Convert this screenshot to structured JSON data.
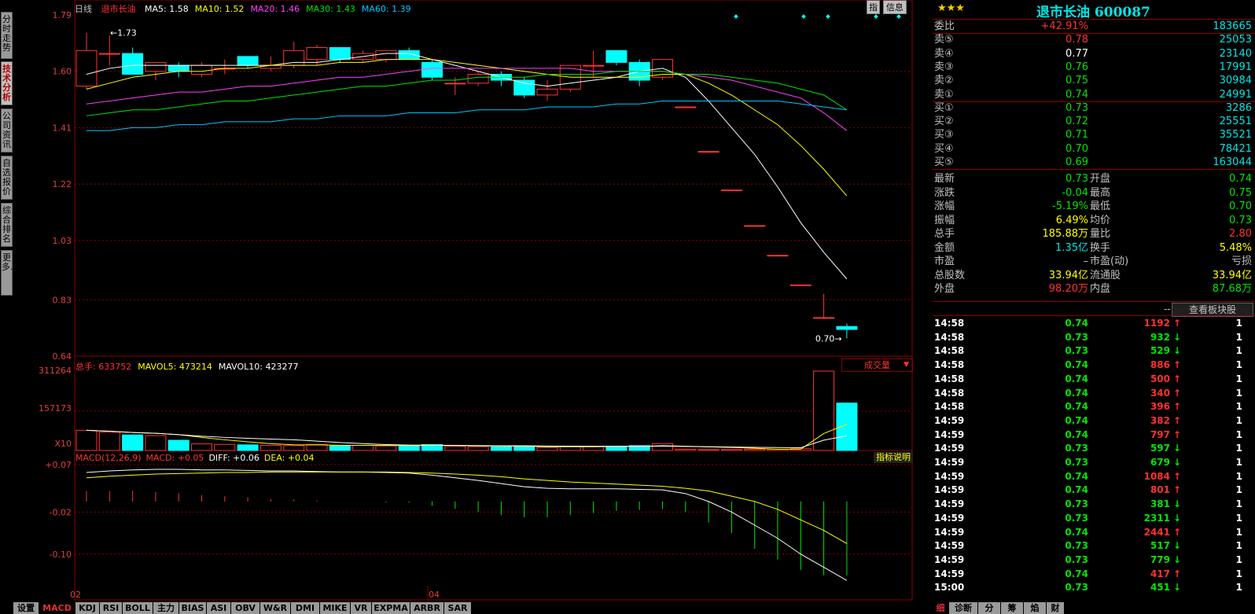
{
  "left_tabs": [
    "分时走势",
    "技术分析",
    "公司资讯",
    "自选报价",
    "综合排名",
    "更多..."
  ],
  "left_tab_active": 1,
  "chart": {
    "period_label": "日线",
    "stock_name": "退市长油",
    "ma_labels": [
      {
        "text": "MA5: 1.58",
        "color": "#ffffff"
      },
      {
        "text": "MA10: 1.52",
        "color": "#ffff00"
      },
      {
        "text": "MA20: 1.46",
        "color": "#ff40ff"
      },
      {
        "text": "MA30: 1.43",
        "color": "#00e600"
      },
      {
        "text": "MA60: 1.39",
        "color": "#00c8ff"
      }
    ],
    "top_buttons": [
      "指",
      "信息"
    ],
    "price_ticks": [
      "1.79",
      "1.60",
      "1.41",
      "1.22",
      "1.03",
      "0.83",
      "0.64"
    ],
    "high_note": "1.73",
    "low_note": "0.70",
    "volume_header": [
      {
        "text": "总手: 633752",
        "color": "#ff3232"
      },
      {
        "text": "MAVOL5: 473214",
        "color": "#ffff00"
      },
      {
        "text": "MAVOL10: 423277",
        "color": "#ffffff"
      }
    ],
    "volume_selector": "成交量",
    "volume_ticks": [
      "311264",
      "157173",
      "X10"
    ],
    "macd_header": [
      {
        "text": "MACD(12,26,9)",
        "color": "#ff3232"
      },
      {
        "text": "MACD: +0.05",
        "color": "#ff3232"
      },
      {
        "text": "DIFF: +0.06",
        "color": "#ffffff"
      },
      {
        "text": "DEA: +0.04",
        "color": "#ffff00"
      }
    ],
    "macd_help": "指标说明",
    "macd_ticks": [
      "+0.07",
      "-0.02",
      "-0.10"
    ],
    "date_labels": [
      "02",
      "04"
    ]
  },
  "chart_data": {
    "type": "candlestick",
    "title": "退市长油",
    "ylim": [
      0.64,
      1.79
    ],
    "candles": [
      {
        "o": 1.55,
        "h": 1.73,
        "l": 1.54,
        "c": 1.67
      },
      {
        "o": 1.66,
        "h": 1.72,
        "l": 1.62,
        "c": 1.66
      },
      {
        "o": 1.66,
        "h": 1.68,
        "l": 1.59,
        "c": 1.59
      },
      {
        "o": 1.6,
        "h": 1.63,
        "l": 1.57,
        "c": 1.63
      },
      {
        "o": 1.62,
        "h": 1.63,
        "l": 1.58,
        "c": 1.6
      },
      {
        "o": 1.59,
        "h": 1.63,
        "l": 1.58,
        "c": 1.62
      },
      {
        "o": 1.61,
        "h": 1.64,
        "l": 1.59,
        "c": 1.61
      },
      {
        "o": 1.65,
        "h": 1.65,
        "l": 1.61,
        "c": 1.62
      },
      {
        "o": 1.61,
        "h": 1.65,
        "l": 1.6,
        "c": 1.62
      },
      {
        "o": 1.62,
        "h": 1.7,
        "l": 1.61,
        "c": 1.67
      },
      {
        "o": 1.64,
        "h": 1.69,
        "l": 1.62,
        "c": 1.68
      },
      {
        "o": 1.68,
        "h": 1.68,
        "l": 1.63,
        "c": 1.64
      },
      {
        "o": 1.64,
        "h": 1.67,
        "l": 1.63,
        "c": 1.66
      },
      {
        "o": 1.64,
        "h": 1.67,
        "l": 1.63,
        "c": 1.67
      },
      {
        "o": 1.67,
        "h": 1.68,
        "l": 1.64,
        "c": 1.64
      },
      {
        "o": 1.63,
        "h": 1.64,
        "l": 1.57,
        "c": 1.58
      },
      {
        "o": 1.56,
        "h": 1.58,
        "l": 1.52,
        "c": 1.56
      },
      {
        "o": 1.56,
        "h": 1.6,
        "l": 1.55,
        "c": 1.59
      },
      {
        "o": 1.59,
        "h": 1.6,
        "l": 1.55,
        "c": 1.57
      },
      {
        "o": 1.57,
        "h": 1.58,
        "l": 1.51,
        "c": 1.52
      },
      {
        "o": 1.52,
        "h": 1.57,
        "l": 1.5,
        "c": 1.54
      },
      {
        "o": 1.54,
        "h": 1.62,
        "l": 1.53,
        "c": 1.62
      },
      {
        "o": 1.62,
        "h": 1.67,
        "l": 1.58,
        "c": 1.62
      },
      {
        "o": 1.67,
        "h": 1.67,
        "l": 1.62,
        "c": 1.63
      },
      {
        "o": 1.63,
        "h": 1.64,
        "l": 1.55,
        "c": 1.57
      },
      {
        "o": 1.58,
        "h": 1.64,
        "l": 1.57,
        "c": 1.64
      },
      {
        "o": 1.48,
        "h": 1.48,
        "l": 1.48,
        "c": 1.48
      },
      {
        "o": 1.33,
        "h": 1.33,
        "l": 1.33,
        "c": 1.33
      },
      {
        "o": 1.2,
        "h": 1.2,
        "l": 1.2,
        "c": 1.2
      },
      {
        "o": 1.08,
        "h": 1.08,
        "l": 1.08,
        "c": 1.08
      },
      {
        "o": 0.98,
        "h": 0.98,
        "l": 0.98,
        "c": 0.98
      },
      {
        "o": 0.88,
        "h": 0.88,
        "l": 0.88,
        "c": 0.88
      },
      {
        "o": 0.77,
        "h": 0.85,
        "l": 0.77,
        "c": 0.77
      },
      {
        "o": 0.74,
        "h": 0.75,
        "l": 0.7,
        "c": 0.73
      }
    ],
    "ma_series": {
      "MA5": [
        1.59,
        1.61,
        1.62,
        1.62,
        1.62,
        1.62,
        1.62,
        1.62,
        1.62,
        1.63,
        1.63,
        1.64,
        1.65,
        1.66,
        1.66,
        1.64,
        1.62,
        1.6,
        1.58,
        1.56,
        1.55,
        1.56,
        1.57,
        1.58,
        1.6,
        1.61,
        1.58,
        1.5,
        1.41,
        1.32,
        1.21,
        1.09,
        0.99,
        0.9
      ],
      "MA10": [
        1.54,
        1.56,
        1.58,
        1.59,
        1.6,
        1.6,
        1.61,
        1.61,
        1.62,
        1.62,
        1.62,
        1.63,
        1.63,
        1.64,
        1.64,
        1.64,
        1.63,
        1.62,
        1.61,
        1.6,
        1.59,
        1.58,
        1.58,
        1.58,
        1.58,
        1.59,
        1.59,
        1.56,
        1.52,
        1.47,
        1.42,
        1.35,
        1.27,
        1.18
      ],
      "MA20": [
        1.49,
        1.5,
        1.51,
        1.52,
        1.53,
        1.53,
        1.54,
        1.55,
        1.55,
        1.56,
        1.57,
        1.58,
        1.58,
        1.59,
        1.6,
        1.61,
        1.61,
        1.61,
        1.61,
        1.61,
        1.61,
        1.61,
        1.6,
        1.6,
        1.6,
        1.6,
        1.59,
        1.58,
        1.57,
        1.55,
        1.53,
        1.51,
        1.46,
        1.4
      ],
      "MA30": [
        1.45,
        1.46,
        1.47,
        1.47,
        1.48,
        1.49,
        1.5,
        1.5,
        1.51,
        1.52,
        1.53,
        1.54,
        1.55,
        1.55,
        1.56,
        1.57,
        1.57,
        1.58,
        1.58,
        1.58,
        1.59,
        1.59,
        1.59,
        1.6,
        1.6,
        1.6,
        1.59,
        1.59,
        1.58,
        1.57,
        1.56,
        1.54,
        1.52,
        1.47
      ],
      "MA60": [
        1.4,
        1.4,
        1.41,
        1.41,
        1.42,
        1.42,
        1.43,
        1.43,
        1.43,
        1.44,
        1.44,
        1.45,
        1.45,
        1.45,
        1.46,
        1.46,
        1.46,
        1.47,
        1.47,
        1.47,
        1.48,
        1.48,
        1.48,
        1.49,
        1.49,
        1.5,
        1.5,
        1.5,
        1.5,
        1.5,
        1.5,
        1.49,
        1.48,
        1.47
      ]
    },
    "volume": [
      79000,
      72000,
      61000,
      58000,
      40000,
      26000,
      24000,
      22000,
      20000,
      19000,
      24000,
      18000,
      20000,
      18000,
      19000,
      23000,
      16000,
      15000,
      14000,
      17000,
      12000,
      16000,
      15000,
      17000,
      19000,
      27000,
      5000,
      4000,
      4000,
      5000,
      5000,
      7000,
      311264,
      185880
    ],
    "macd_ylim": [
      -0.16,
      0.07
    ],
    "diff": [
      0.055,
      0.058,
      0.06,
      0.061,
      0.061,
      0.06,
      0.06,
      0.059,
      0.058,
      0.058,
      0.057,
      0.056,
      0.056,
      0.055,
      0.054,
      0.05,
      0.045,
      0.04,
      0.034,
      0.028,
      0.025,
      0.024,
      0.024,
      0.024,
      0.023,
      0.022,
      0.015,
      0.0,
      -0.02,
      -0.045,
      -0.07,
      -0.1,
      -0.125,
      -0.15
    ],
    "dea": [
      0.045,
      0.048,
      0.05,
      0.052,
      0.053,
      0.054,
      0.055,
      0.055,
      0.056,
      0.056,
      0.056,
      0.056,
      0.056,
      0.056,
      0.055,
      0.054,
      0.052,
      0.05,
      0.047,
      0.043,
      0.04,
      0.037,
      0.035,
      0.033,
      0.031,
      0.029,
      0.025,
      0.02,
      0.01,
      0.0,
      -0.015,
      -0.035,
      -0.055,
      -0.08
    ]
  },
  "quote": {
    "stars": "★★★",
    "title": "退市长油 600087",
    "rows": [
      {
        "label": "委比",
        "v1": "+42.91%",
        "c1": "red",
        "v2": "183665",
        "c2": "cyan"
      },
      {
        "label": "卖⑤",
        "v1": "0.78",
        "c1": "red",
        "v2": "25053",
        "c2": "cyan"
      },
      {
        "label": "卖④",
        "v1": "0.77",
        "c1": "white",
        "v2": "23140",
        "c2": "cyan"
      },
      {
        "label": "卖③",
        "v1": "0.76",
        "c1": "green",
        "v2": "17991",
        "c2": "cyan"
      },
      {
        "label": "卖②",
        "v1": "0.75",
        "c1": "green",
        "v2": "30984",
        "c2": "cyan"
      },
      {
        "label": "卖①",
        "v1": "0.74",
        "c1": "green",
        "v2": "24991",
        "c2": "cyan"
      },
      {
        "label": "买①",
        "v1": "0.73",
        "c1": "green",
        "v2": "3286",
        "c2": "cyan"
      },
      {
        "label": "买②",
        "v1": "0.72",
        "c1": "green",
        "v2": "25551",
        "c2": "cyan"
      },
      {
        "label": "买③",
        "v1": "0.71",
        "c1": "green",
        "v2": "35521",
        "c2": "cyan"
      },
      {
        "label": "买④",
        "v1": "0.70",
        "c1": "green",
        "v2": "78421",
        "c2": "cyan"
      },
      {
        "label": "买⑤",
        "v1": "0.69",
        "c1": "green",
        "v2": "163044",
        "c2": "cyan"
      }
    ],
    "stats": [
      {
        "l1": "最新",
        "v1": "0.73",
        "c1": "green",
        "l2": "开盘",
        "v2": "0.74",
        "c2": "green"
      },
      {
        "l1": "涨跌",
        "v1": "-0.04",
        "c1": "green",
        "l2": "最高",
        "v2": "0.75",
        "c2": "green"
      },
      {
        "l1": "涨幅",
        "v1": "-5.19%",
        "c1": "green",
        "l2": "最低",
        "v2": "0.70",
        "c2": "green"
      },
      {
        "l1": "振幅",
        "v1": "6.49%",
        "c1": "yellow",
        "l2": "均价",
        "v2": "0.73",
        "c2": "green"
      },
      {
        "l1": "总手",
        "v1": "185.88万",
        "c1": "yellow",
        "l2": "量比",
        "v2": "2.80",
        "c2": "red"
      },
      {
        "l1": "金额",
        "v1": "1.35亿",
        "c1": "cyan",
        "l2": "换手",
        "v2": "5.48%",
        "c2": "yellow"
      },
      {
        "l1": "市盈",
        "v1": "–",
        "c1": "lbl",
        "l2": "市盈(动)",
        "v2": "亏损",
        "c2": "lbl"
      },
      {
        "l1": "总股数",
        "v1": "33.94亿",
        "c1": "yellow",
        "l2": "流通股",
        "v2": "33.94亿",
        "c2": "yellow"
      },
      {
        "l1": "外盘",
        "v1": "98.20万",
        "c1": "red",
        "l2": "内盘",
        "v2": "87.68万",
        "c2": "green"
      }
    ],
    "sector_button": "查看板块股",
    "sector_prefix": "--",
    "ticks": [
      {
        "t": "14:58",
        "p": "0.74",
        "v": "1192",
        "d": "up",
        "n": "1"
      },
      {
        "t": "14:58",
        "p": "0.73",
        "v": "932",
        "d": "down",
        "n": "1"
      },
      {
        "t": "14:58",
        "p": "0.73",
        "v": "529",
        "d": "down",
        "n": "1"
      },
      {
        "t": "14:58",
        "p": "0.74",
        "v": "886",
        "d": "up",
        "n": "1"
      },
      {
        "t": "14:58",
        "p": "0.74",
        "v": "500",
        "d": "up",
        "n": "1"
      },
      {
        "t": "14:58",
        "p": "0.74",
        "v": "340",
        "d": "up",
        "n": "1"
      },
      {
        "t": "14:58",
        "p": "0.74",
        "v": "396",
        "d": "up",
        "n": "1"
      },
      {
        "t": "14:59",
        "p": "0.74",
        "v": "382",
        "d": "up",
        "n": "1"
      },
      {
        "t": "14:59",
        "p": "0.74",
        "v": "797",
        "d": "up",
        "n": "1"
      },
      {
        "t": "14:59",
        "p": "0.73",
        "v": "597",
        "d": "down",
        "n": "1"
      },
      {
        "t": "14:59",
        "p": "0.73",
        "v": "679",
        "d": "down",
        "n": "1"
      },
      {
        "t": "14:59",
        "p": "0.74",
        "v": "1084",
        "d": "up",
        "n": "1"
      },
      {
        "t": "14:59",
        "p": "0.74",
        "v": "801",
        "d": "up",
        "n": "1"
      },
      {
        "t": "14:59",
        "p": "0.73",
        "v": "381",
        "d": "down",
        "n": "1"
      },
      {
        "t": "14:59",
        "p": "0.73",
        "v": "2311",
        "d": "down",
        "n": "1"
      },
      {
        "t": "14:59",
        "p": "0.74",
        "v": "2441",
        "d": "up",
        "n": "1"
      },
      {
        "t": "14:59",
        "p": "0.73",
        "v": "517",
        "d": "down",
        "n": "1"
      },
      {
        "t": "14:59",
        "p": "0.73",
        "v": "779",
        "d": "down",
        "n": "1"
      },
      {
        "t": "14:59",
        "p": "0.74",
        "v": "417",
        "d": "up",
        "n": "1"
      },
      {
        "t": "15:00",
        "p": "0.73",
        "v": "451",
        "d": "down",
        "n": "1"
      }
    ],
    "bottom_tabs": [
      "细",
      "诊断",
      "分",
      "筹",
      "焰",
      "财"
    ]
  },
  "bottom_tabs": [
    "设置",
    "MACD",
    "KDJ",
    "RSI",
    "BOLL",
    "主力",
    "BIAS",
    "ASI",
    "OBV",
    "W&R",
    "DMI",
    "MIKE",
    "VR",
    "EXPMA",
    "ARBR",
    "SAR"
  ],
  "bottom_tab_active": 1,
  "colors": {
    "up": "#ff3232",
    "down": "#00ffff",
    "grid": "#8b0000",
    "bg": "#000000"
  }
}
